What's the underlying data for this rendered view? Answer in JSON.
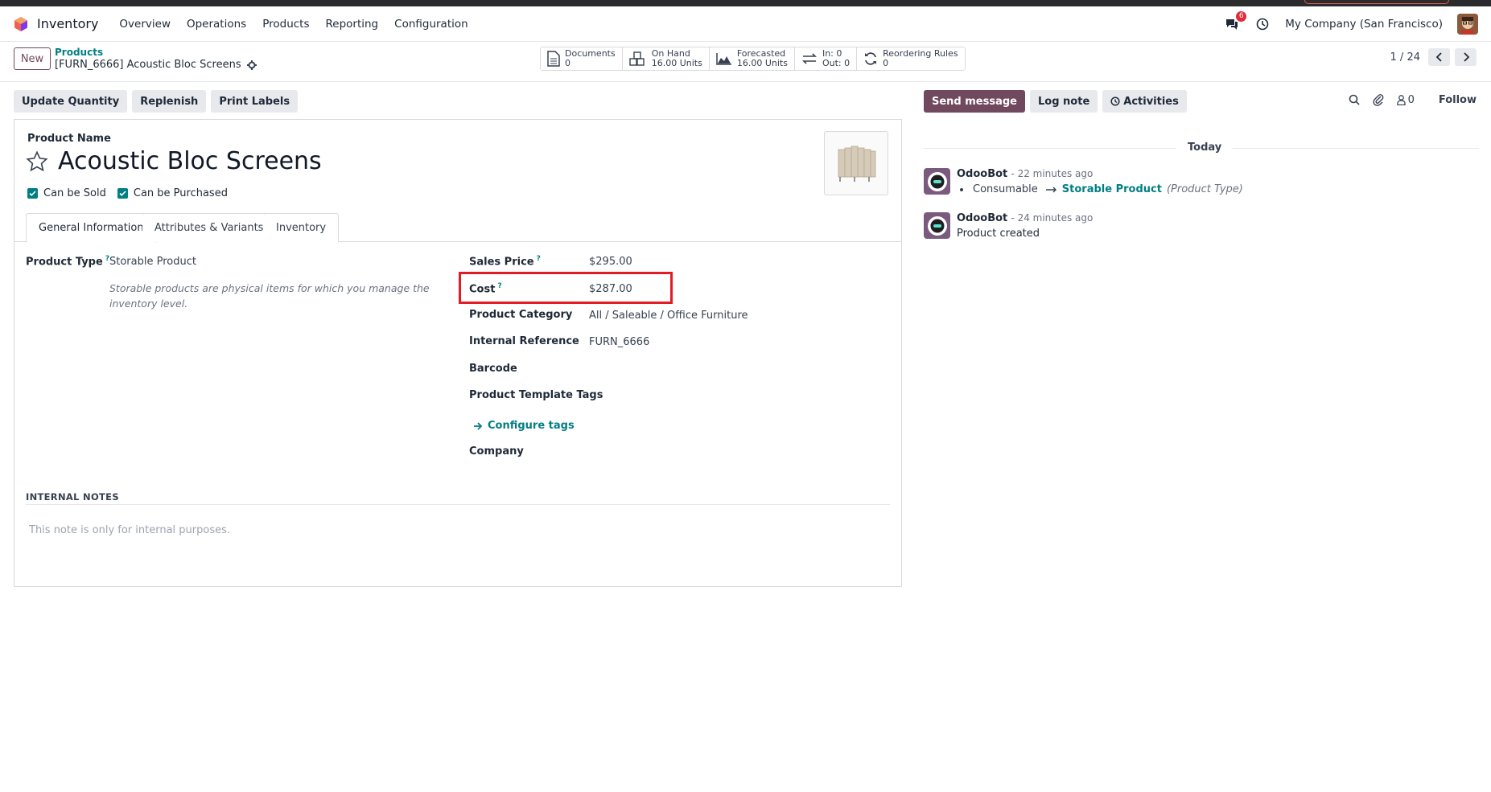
{
  "nav": {
    "app_name": "Inventory",
    "menu": [
      "Overview",
      "Operations",
      "Products",
      "Reporting",
      "Configuration"
    ],
    "message_badge": "6",
    "company": "My Company (San Francisco)"
  },
  "control": {
    "new_label": "New",
    "breadcrumb_parent": "Products",
    "breadcrumb_current": "[FURN_6666] Acoustic Bloc Screens",
    "smart_buttons": [
      {
        "label": "Documents",
        "value": "0",
        "icon": "document-icon"
      },
      {
        "label": "On Hand",
        "value": "16.00 Units",
        "icon": "cubes-icon"
      },
      {
        "label": "Forecasted",
        "value": "16.00 Units",
        "icon": "area-chart-icon"
      },
      {
        "label": "In: 0",
        "value": "Out: 0",
        "icon": "exchange-icon"
      },
      {
        "label": "Reordering Rules",
        "value": "0",
        "icon": "refresh-icon"
      }
    ],
    "pager": "1 / 24"
  },
  "actions": [
    "Update Quantity",
    "Replenish",
    "Print Labels"
  ],
  "form": {
    "product_name_label": "Product Name",
    "product_name": "Acoustic Bloc Screens",
    "can_be_sold": "Can be Sold",
    "can_be_purchased": "Can be Purchased",
    "tabs": [
      "General Information",
      "Attributes & Variants",
      "Inventory"
    ],
    "product_type_label": "Product Type",
    "product_type": "Storable Product",
    "product_type_help": "Storable products are physical items for which you manage the inventory level.",
    "sales_price_label": "Sales Price",
    "sales_price": "$295.00",
    "cost_label": "Cost",
    "cost": "$287.00",
    "category_label": "Product Category",
    "category": "All / Saleable / Office Furniture",
    "internal_ref_label": "Internal Reference",
    "internal_ref": "FURN_6666",
    "barcode_label": "Barcode",
    "tags_label": "Product Template Tags",
    "configure_tags": "Configure tags",
    "company_label": "Company",
    "help_marker": "?",
    "internal_notes_title": "INTERNAL NOTES",
    "internal_notes_placeholder": "This note is only for internal purposes."
  },
  "chatter": {
    "send_message": "Send message",
    "log_note": "Log note",
    "activities": "Activities",
    "followers_count": "0",
    "follow": "Follow",
    "today": "Today",
    "messages": [
      {
        "author": "OdooBot",
        "time": "- 22 minutes ago",
        "old_value": "Consumable",
        "new_value": "Storable Product",
        "field": "(Product Type)"
      },
      {
        "author": "OdooBot",
        "time": "- 24 minutes ago",
        "body": "Product created"
      }
    ]
  },
  "colors": {
    "primary": "#71495f",
    "link": "#017e84",
    "highlight": "#e31b23"
  }
}
